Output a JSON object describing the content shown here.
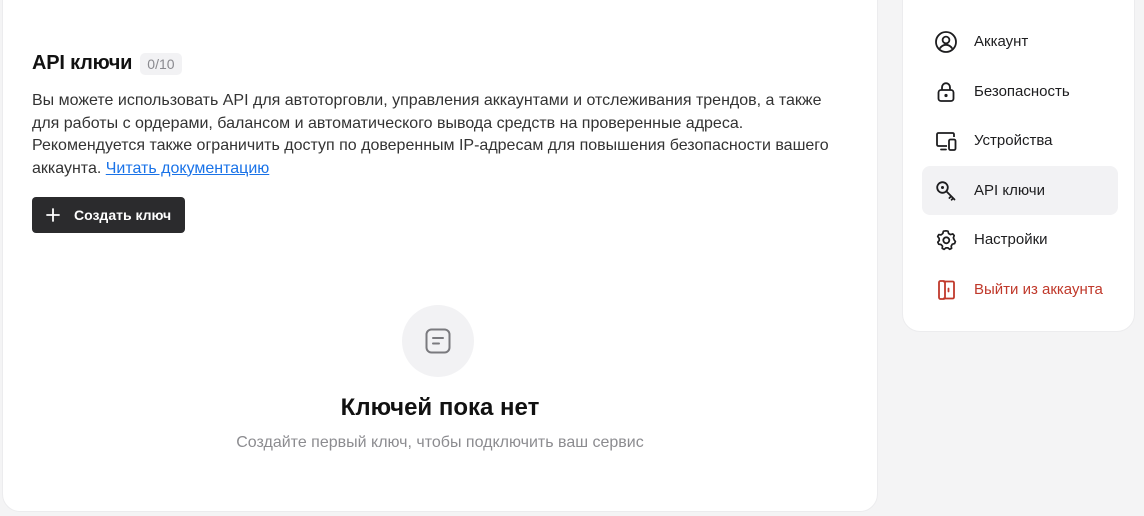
{
  "main": {
    "title": "API ключи",
    "count_badge": "0/10",
    "description": "Вы можете использовать API для автоторговли, управления аккаунтами и отслеживания трендов, а также для работы с ордерами, балансом и автоматического вывода средств на проверенные адреса. Рекомендуется также ограничить доступ по доверенным IP-адресам для повышения безопасности вашего аккаунта.",
    "doc_link": "Читать документацию",
    "create_button": {
      "label": "Создать ключ",
      "icon": "plus-icon"
    },
    "empty_state": {
      "icon": "document-icon",
      "title": "Ключей пока нет",
      "subtitle": "Создайте первый ключ, чтобы подключить ваш сервис"
    }
  },
  "sidebar": {
    "items": [
      {
        "label": "Аккаунт",
        "icon": "user-circle-icon",
        "active": false
      },
      {
        "label": "Безопасность",
        "icon": "lock-icon",
        "active": false
      },
      {
        "label": "Устройства",
        "icon": "devices-icon",
        "active": false
      },
      {
        "label": "API ключи",
        "icon": "key-icon",
        "active": true
      },
      {
        "label": "Настройки",
        "icon": "gear-icon",
        "active": false
      },
      {
        "label": "Выйти из аккаунта",
        "icon": "logout-icon",
        "active": false,
        "danger": true
      }
    ]
  },
  "colors": {
    "link": "#1a73e8",
    "primary_button": "#2b2b2d",
    "danger": "#c0392b",
    "active_item_bg": "#f2f2f4"
  }
}
